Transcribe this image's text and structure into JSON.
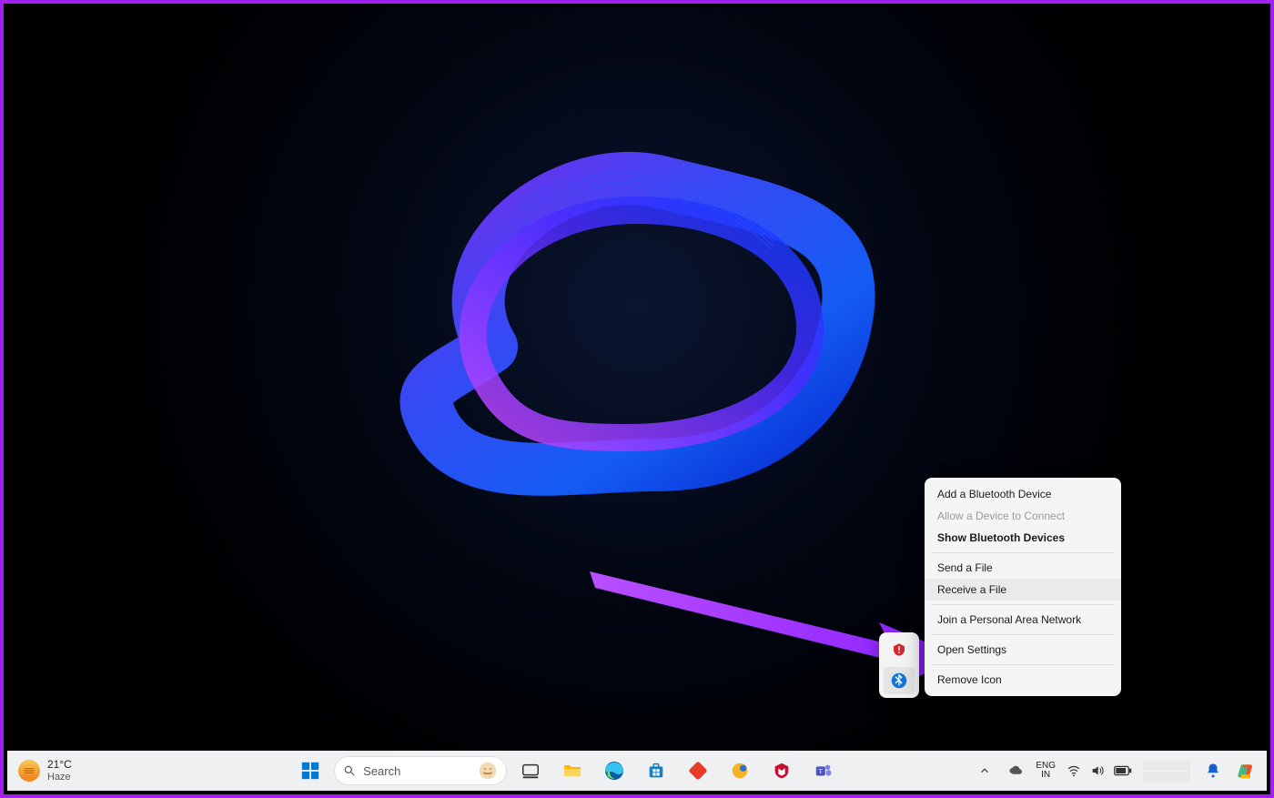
{
  "weather": {
    "temp": "21°C",
    "condition": "Haze"
  },
  "search": {
    "placeholder": "Search"
  },
  "context_menu": {
    "items": [
      {
        "label": "Add a Bluetooth Device",
        "disabled": false,
        "bold": false
      },
      {
        "label": "Allow a Device to Connect",
        "disabled": true,
        "bold": false
      },
      {
        "label": "Show Bluetooth Devices",
        "disabled": false,
        "bold": true
      },
      {
        "sep": true
      },
      {
        "label": "Send a File",
        "disabled": false,
        "bold": false
      },
      {
        "label": "Receive a File",
        "disabled": false,
        "bold": false,
        "hover": true
      },
      {
        "sep": true
      },
      {
        "label": "Join a Personal Area Network",
        "disabled": false,
        "bold": false
      },
      {
        "sep": true
      },
      {
        "label": "Open Settings",
        "disabled": false,
        "bold": false
      },
      {
        "sep": true
      },
      {
        "label": "Remove Icon",
        "disabled": false,
        "bold": false
      }
    ]
  },
  "language": {
    "line1": "ENG",
    "line2": "IN"
  },
  "taskbar_icons": [
    "start",
    "search",
    "copilot",
    "task-view",
    "file-explorer",
    "edge",
    "microsoft-store",
    "todo",
    "weather-app",
    "mcafee",
    "teams"
  ],
  "tray_icons": [
    "onedrive",
    "wifi",
    "volume",
    "battery"
  ],
  "tray_popup_icons": [
    "mcafee-update",
    "bluetooth"
  ],
  "colors": {
    "accent_purple": "#a020f0",
    "menu_bg": "#f5f5f5",
    "taskbar_bg": "#eef0f2"
  }
}
